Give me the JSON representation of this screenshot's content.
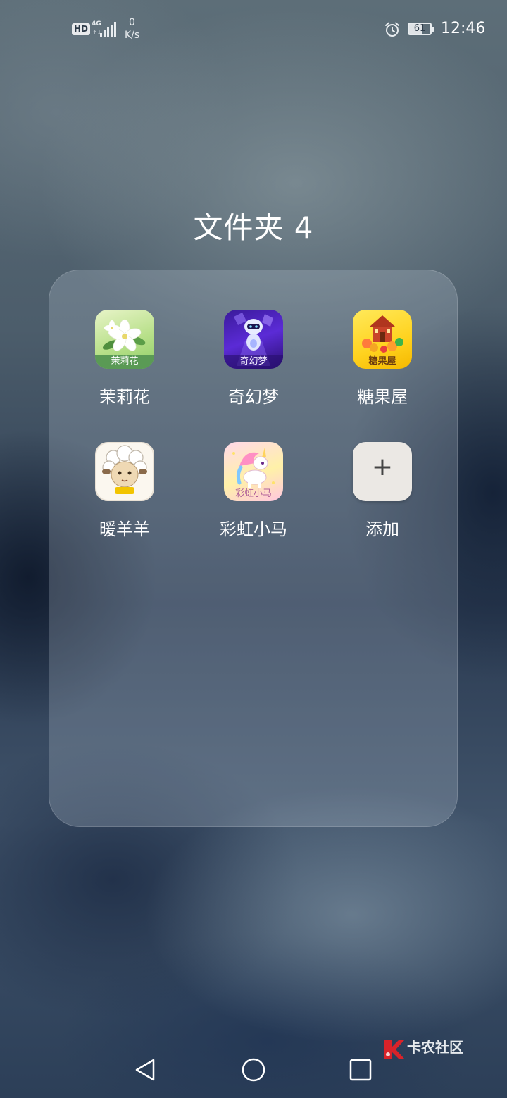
{
  "status_bar": {
    "hd_badge": "HD",
    "network_type": "4G",
    "network_arrows": "↑↓",
    "net_speed_value": "0",
    "net_speed_unit": "K/s",
    "battery_level": "61",
    "time": "12:46",
    "icons": [
      "signal-icon",
      "alarm-icon",
      "battery-icon"
    ]
  },
  "folder": {
    "title": "文件夹 4",
    "apps": [
      {
        "label": "茉莉花",
        "icon_caption": "茉莉花",
        "icon": "jasmine-flower-icon"
      },
      {
        "label": "奇幻梦",
        "icon_caption": "奇幻梦",
        "icon": "fantasy-robot-icon"
      },
      {
        "label": "糖果屋",
        "icon_caption": "糖果屋",
        "icon": "candy-house-icon"
      },
      {
        "label": "暖羊羊",
        "icon_caption": "",
        "icon": "sheep-character-icon"
      },
      {
        "label": "彩虹小马",
        "icon_caption": "彩虹小马",
        "icon": "unicorn-pony-icon"
      },
      {
        "label": "添加",
        "icon_caption": "+",
        "icon": "add-plus-icon"
      }
    ]
  },
  "watermark": {
    "text": "卡农社区",
    "icon": "kanong-logo-icon"
  },
  "navigation": {
    "buttons": [
      "back-triangle-icon",
      "home-circle-icon",
      "recents-square-icon"
    ]
  },
  "colors": {
    "text": "#ffffff",
    "panel": "#c3d0de",
    "background_top": "#5d6e78",
    "background_bottom": "#2c3f58"
  }
}
